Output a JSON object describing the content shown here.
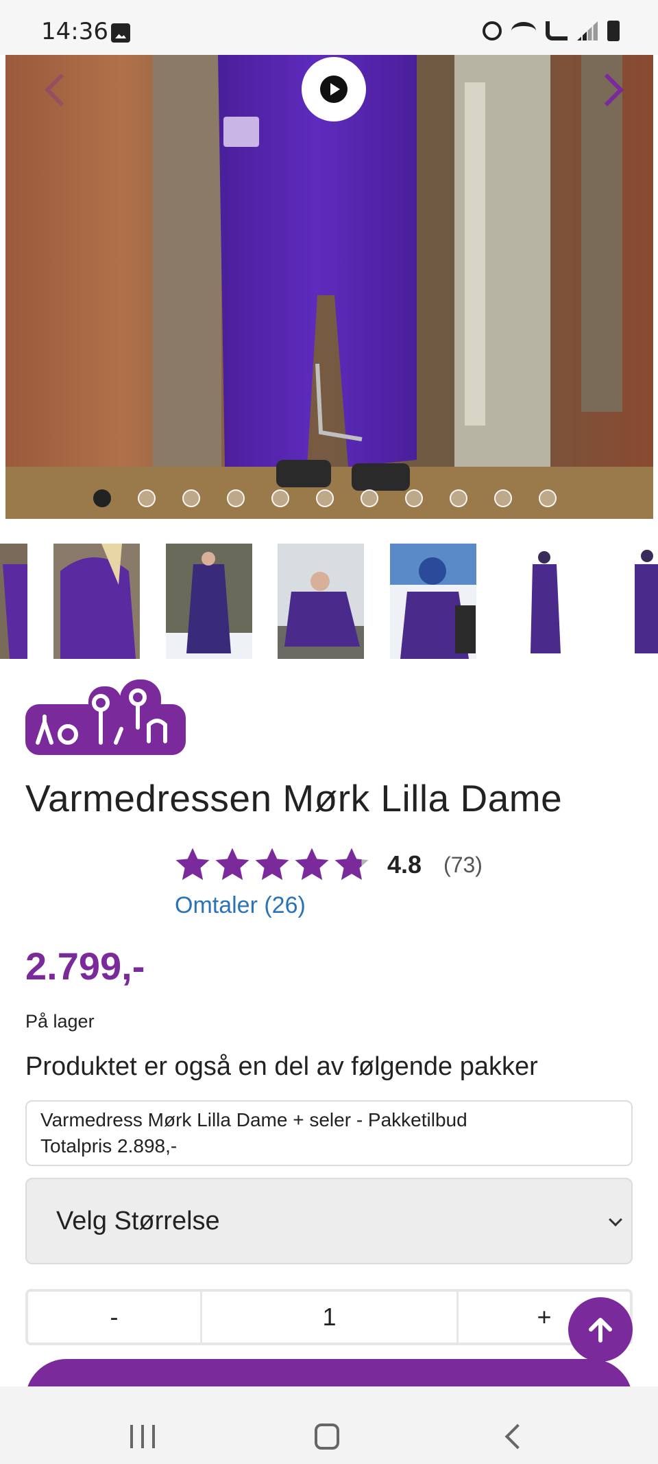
{
  "status_bar": {
    "time": "14:36",
    "icons": [
      "image-icon",
      "alarm-icon",
      "wifi-icon",
      "wifi-call-icon",
      "signal-icon",
      "battery-icon"
    ]
  },
  "gallery": {
    "slide_count": 11,
    "active_slide": 1,
    "thumbnails": [
      "thumb-1",
      "thumb-2",
      "thumb-3",
      "thumb-4",
      "thumb-5",
      "thumb-6",
      "thumb-7"
    ]
  },
  "brand": {
    "name": "hoppin",
    "color": "#7b2a9b"
  },
  "product": {
    "title": "Varmedressen Mørk Lilla Dame",
    "rating": "4.8",
    "rating_value": 4.8,
    "rating_count": "(73)",
    "reviews_link": "Omtaler (26)",
    "price": "2.799,-",
    "stock": "På lager"
  },
  "packages": {
    "heading": "Produktet er også en del av følgende pakker",
    "item_name": "Varmedress Mørk Lilla Dame + seler - Pakketilbud",
    "item_total": "Totalpris 2.898,-"
  },
  "size_select": {
    "label": "Velg Størrelse"
  },
  "quantity": {
    "minus": "-",
    "value": "1",
    "plus": "+"
  },
  "colors": {
    "accent": "#7b2a9b",
    "link": "#2a73b8",
    "star": "#7b2a9b"
  }
}
